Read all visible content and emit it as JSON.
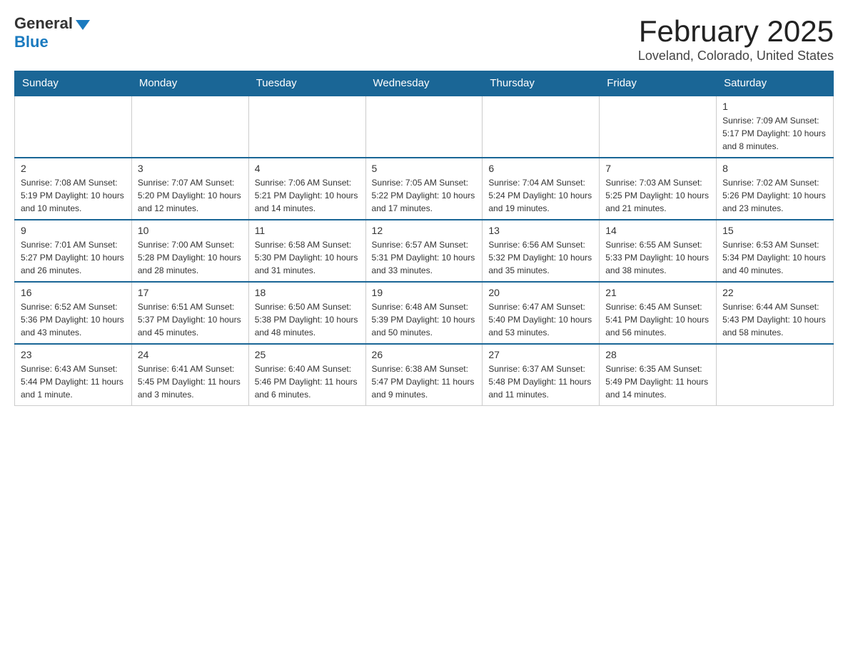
{
  "header": {
    "logo_general": "General",
    "logo_blue": "Blue",
    "month_title": "February 2025",
    "location": "Loveland, Colorado, United States"
  },
  "days_of_week": [
    "Sunday",
    "Monday",
    "Tuesday",
    "Wednesday",
    "Thursday",
    "Friday",
    "Saturday"
  ],
  "weeks": [
    [
      {
        "day": "",
        "info": ""
      },
      {
        "day": "",
        "info": ""
      },
      {
        "day": "",
        "info": ""
      },
      {
        "day": "",
        "info": ""
      },
      {
        "day": "",
        "info": ""
      },
      {
        "day": "",
        "info": ""
      },
      {
        "day": "1",
        "info": "Sunrise: 7:09 AM\nSunset: 5:17 PM\nDaylight: 10 hours and 8 minutes."
      }
    ],
    [
      {
        "day": "2",
        "info": "Sunrise: 7:08 AM\nSunset: 5:19 PM\nDaylight: 10 hours and 10 minutes."
      },
      {
        "day": "3",
        "info": "Sunrise: 7:07 AM\nSunset: 5:20 PM\nDaylight: 10 hours and 12 minutes."
      },
      {
        "day": "4",
        "info": "Sunrise: 7:06 AM\nSunset: 5:21 PM\nDaylight: 10 hours and 14 minutes."
      },
      {
        "day": "5",
        "info": "Sunrise: 7:05 AM\nSunset: 5:22 PM\nDaylight: 10 hours and 17 minutes."
      },
      {
        "day": "6",
        "info": "Sunrise: 7:04 AM\nSunset: 5:24 PM\nDaylight: 10 hours and 19 minutes."
      },
      {
        "day": "7",
        "info": "Sunrise: 7:03 AM\nSunset: 5:25 PM\nDaylight: 10 hours and 21 minutes."
      },
      {
        "day": "8",
        "info": "Sunrise: 7:02 AM\nSunset: 5:26 PM\nDaylight: 10 hours and 23 minutes."
      }
    ],
    [
      {
        "day": "9",
        "info": "Sunrise: 7:01 AM\nSunset: 5:27 PM\nDaylight: 10 hours and 26 minutes."
      },
      {
        "day": "10",
        "info": "Sunrise: 7:00 AM\nSunset: 5:28 PM\nDaylight: 10 hours and 28 minutes."
      },
      {
        "day": "11",
        "info": "Sunrise: 6:58 AM\nSunset: 5:30 PM\nDaylight: 10 hours and 31 minutes."
      },
      {
        "day": "12",
        "info": "Sunrise: 6:57 AM\nSunset: 5:31 PM\nDaylight: 10 hours and 33 minutes."
      },
      {
        "day": "13",
        "info": "Sunrise: 6:56 AM\nSunset: 5:32 PM\nDaylight: 10 hours and 35 minutes."
      },
      {
        "day": "14",
        "info": "Sunrise: 6:55 AM\nSunset: 5:33 PM\nDaylight: 10 hours and 38 minutes."
      },
      {
        "day": "15",
        "info": "Sunrise: 6:53 AM\nSunset: 5:34 PM\nDaylight: 10 hours and 40 minutes."
      }
    ],
    [
      {
        "day": "16",
        "info": "Sunrise: 6:52 AM\nSunset: 5:36 PM\nDaylight: 10 hours and 43 minutes."
      },
      {
        "day": "17",
        "info": "Sunrise: 6:51 AM\nSunset: 5:37 PM\nDaylight: 10 hours and 45 minutes."
      },
      {
        "day": "18",
        "info": "Sunrise: 6:50 AM\nSunset: 5:38 PM\nDaylight: 10 hours and 48 minutes."
      },
      {
        "day": "19",
        "info": "Sunrise: 6:48 AM\nSunset: 5:39 PM\nDaylight: 10 hours and 50 minutes."
      },
      {
        "day": "20",
        "info": "Sunrise: 6:47 AM\nSunset: 5:40 PM\nDaylight: 10 hours and 53 minutes."
      },
      {
        "day": "21",
        "info": "Sunrise: 6:45 AM\nSunset: 5:41 PM\nDaylight: 10 hours and 56 minutes."
      },
      {
        "day": "22",
        "info": "Sunrise: 6:44 AM\nSunset: 5:43 PM\nDaylight: 10 hours and 58 minutes."
      }
    ],
    [
      {
        "day": "23",
        "info": "Sunrise: 6:43 AM\nSunset: 5:44 PM\nDaylight: 11 hours and 1 minute."
      },
      {
        "day": "24",
        "info": "Sunrise: 6:41 AM\nSunset: 5:45 PM\nDaylight: 11 hours and 3 minutes."
      },
      {
        "day": "25",
        "info": "Sunrise: 6:40 AM\nSunset: 5:46 PM\nDaylight: 11 hours and 6 minutes."
      },
      {
        "day": "26",
        "info": "Sunrise: 6:38 AM\nSunset: 5:47 PM\nDaylight: 11 hours and 9 minutes."
      },
      {
        "day": "27",
        "info": "Sunrise: 6:37 AM\nSunset: 5:48 PM\nDaylight: 11 hours and 11 minutes."
      },
      {
        "day": "28",
        "info": "Sunrise: 6:35 AM\nSunset: 5:49 PM\nDaylight: 11 hours and 14 minutes."
      },
      {
        "day": "",
        "info": ""
      }
    ]
  ]
}
